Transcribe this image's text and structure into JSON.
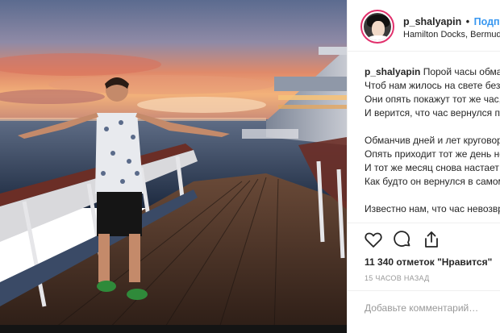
{
  "post": {
    "username": "p_shalyapin",
    "separator": "•",
    "follow_label": "Подписаться",
    "location": "Hamilton Docks, Bermuda",
    "caption_user": "p_shalyapin",
    "caption_lines": [
      "Порой часы обманывают нас,",
      "Чтоб нам жилось на свете безмятежней.",
      "Они опять покажут тот же час,",
      "И верится, что час вернулся прежний.",
      "",
      "Обманчив дней и лет круговорот:",
      "Опять приходит тот же день недели,",
      "И тот же месяц снова настает —",
      "Как будто он вернулся в самом деле.",
      "",
      "Известно нам, что час невозвратим…"
    ],
    "likes": "11 340 отметок \"Нравится\"",
    "time_ago": "15 часов назад",
    "comment_placeholder": "Добавьте комментарий…"
  },
  "icons": {
    "like": "heart-icon",
    "comment": "comment-icon",
    "share": "share-icon"
  },
  "colors": {
    "follow": "#3897f0",
    "text": "#262626",
    "muted": "#999999",
    "avatar_ring": "#e1306c"
  }
}
